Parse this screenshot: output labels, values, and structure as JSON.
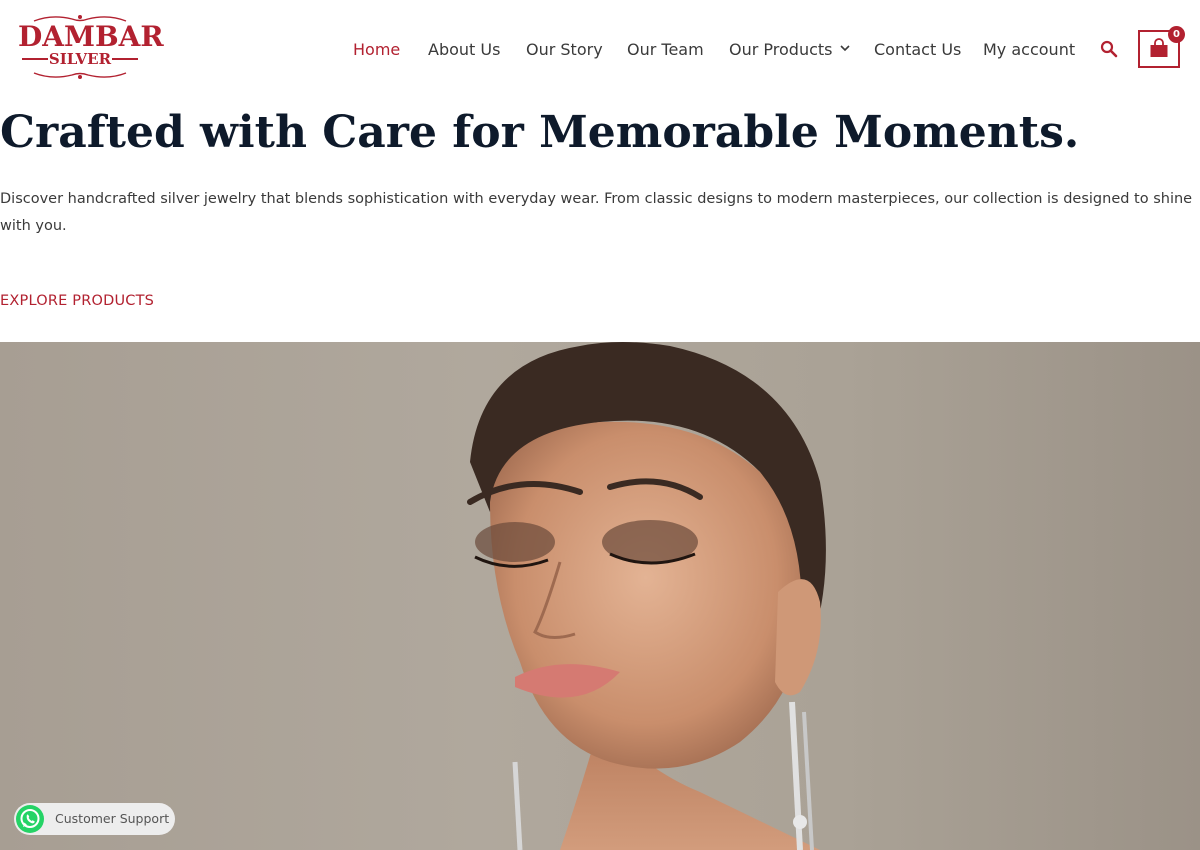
{
  "brand": {
    "name_line1": "DAMBAR",
    "name_line2": "SILVER",
    "accent_color": "#b22130"
  },
  "nav": {
    "items": [
      {
        "label": "Home",
        "active": true
      },
      {
        "label": "About Us"
      },
      {
        "label": "Our Story"
      },
      {
        "label": "Our Team"
      },
      {
        "label": "Our Products",
        "has_dropdown": true
      },
      {
        "label": "Contact Us"
      },
      {
        "label": "My account"
      }
    ],
    "search_icon": "search-icon",
    "cart": {
      "icon": "shopping-bag-icon",
      "count": "0"
    }
  },
  "hero": {
    "title": "Crafted with Care for Memorable Moments.",
    "text": "Discover handcrafted silver jewelry that blends sophistication with everyday wear. From classic designs to modern masterpieces, our collection is designed to shine with you.",
    "cta": "EXPLORE PRODUCTS",
    "image_subject": "model wearing silver drop earrings"
  },
  "support": {
    "label": "Customer Support",
    "icon": "whatsapp-icon"
  }
}
